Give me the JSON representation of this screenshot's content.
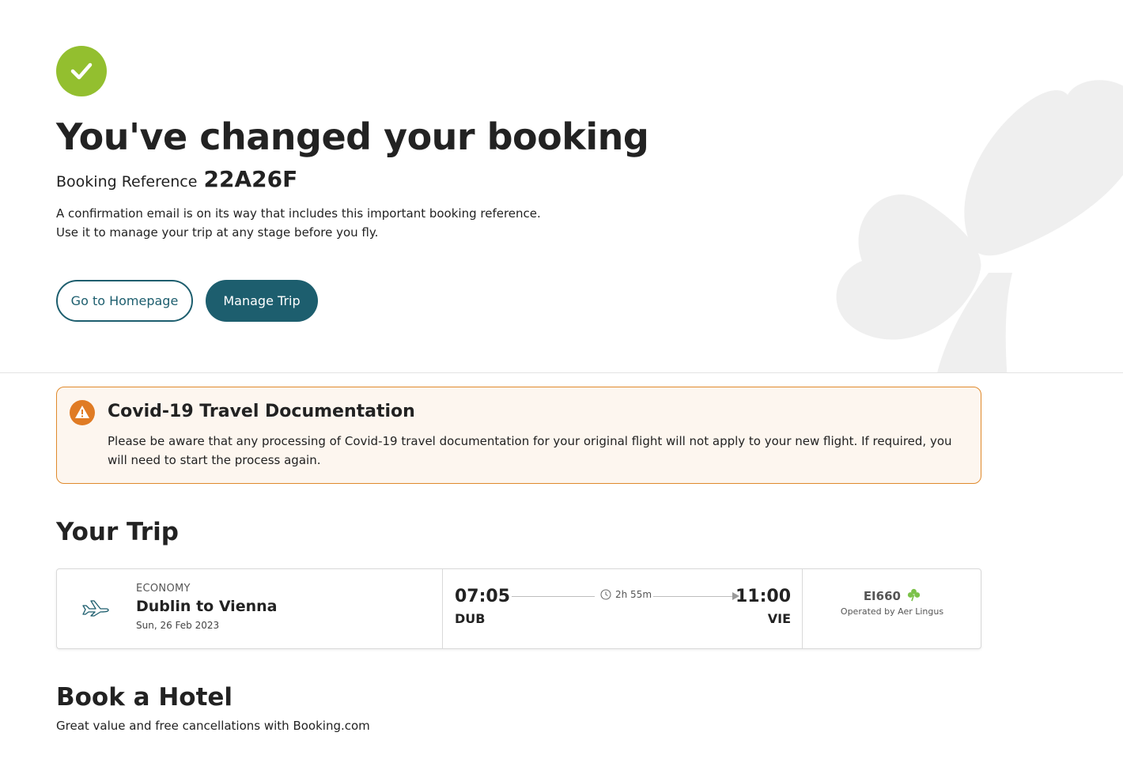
{
  "confirmation": {
    "title": "You've changed your booking",
    "reference_label": "Booking Reference",
    "reference_code": "22A26F",
    "description_line1": "A confirmation email is on its way that includes this important booking reference.",
    "description_line2": "Use it to manage your trip at any stage before you fly.",
    "buttons": {
      "homepage": "Go to Homepage",
      "manage_trip": "Manage Trip"
    }
  },
  "alert": {
    "title": "Covid-19 Travel Documentation",
    "message": "Please be aware that any processing of Covid-19 travel documentation for your original flight will not apply to your new flight. If required, you will need to start the process again."
  },
  "trip": {
    "section_title": "Your Trip",
    "flight": {
      "cabin": "ECONOMY",
      "route": "Dublin to Vienna",
      "date": "Sun, 26 Feb 2023",
      "departure_time": "07:05",
      "departure_code": "DUB",
      "duration": "2h 55m",
      "arrival_time": "11:00",
      "arrival_code": "VIE",
      "flight_number": "EI660",
      "operated_by": "Operated by Aer Lingus"
    }
  },
  "hotel": {
    "section_title": "Book a Hotel",
    "subtitle": "Great value and free cancellations with Booking.com"
  },
  "colors": {
    "brand_teal": "#1d5e6e",
    "success_green": "#93bf2f",
    "warning_orange": "#e07b24",
    "shamrock_green": "#7cc24a"
  },
  "icons": [
    "check-icon",
    "shamrock-watermark",
    "warning-icon",
    "plane-icon",
    "clock-icon",
    "shamrock-icon"
  ]
}
